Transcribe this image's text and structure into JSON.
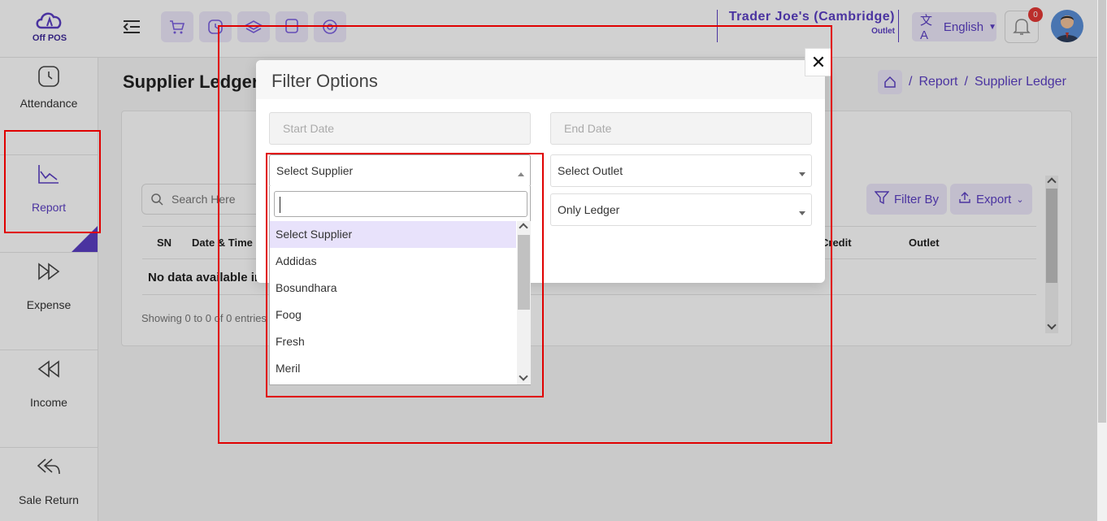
{
  "app": {
    "logo_text": "Off POS"
  },
  "header": {
    "store_name": "Trader Joe's (Cambridge)",
    "store_type": "Outlet",
    "language": "English",
    "notification_count": "0",
    "quick_icons": [
      "cart-icon",
      "clock-icon",
      "layers-icon",
      "bus-icon",
      "globe-icon"
    ]
  },
  "sidebar": {
    "items": [
      {
        "label": "Attendance",
        "icon": "clock-icon"
      },
      {
        "label": "Report",
        "icon": "chart-icon"
      },
      {
        "label": "Expense",
        "icon": "forward-icon"
      },
      {
        "label": "Income",
        "icon": "rewind-icon"
      },
      {
        "label": "Sale Return",
        "icon": "reply-all-icon"
      }
    ]
  },
  "page": {
    "title": "Supplier Ledger",
    "breadcrumb": [
      "Report",
      "Supplier Ledger"
    ],
    "search_placeholder": "Search Here",
    "filter_label": "Filter By",
    "export_label": "Export",
    "columns": [
      "SN",
      "Date & Time",
      "Credit",
      "Outlet"
    ],
    "no_data": "No data available in",
    "showing": "Showing 0 to 0 of 0 entries"
  },
  "modal": {
    "title": "Filter Options",
    "start_date_placeholder": "Start Date",
    "end_date_placeholder": "End Date",
    "supplier_selected": "Select Supplier",
    "outlet_selected": "Select Outlet",
    "ledger_selected": "Only Ledger",
    "supplier_search_value": "",
    "supplier_options": [
      "Select Supplier",
      "Addidas",
      "Bosundhara",
      "Foog",
      "Fresh",
      "Meril"
    ]
  }
}
